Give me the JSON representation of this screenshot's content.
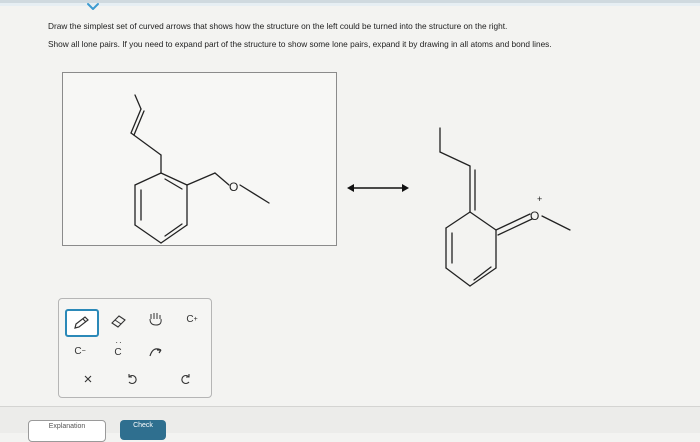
{
  "header": {
    "collapse_icon": "chevron-down-icon",
    "accent_color": "#3d9bd1"
  },
  "instructions": {
    "line1": "Draw the simplest set of curved arrows that shows how the structure on the left could be turned into the structure on the right.",
    "line2": "Show all lone pairs. If you need to expand part of the structure to show some lone pairs, expand it by drawing in all atoms and bond lines."
  },
  "left_structure": {
    "oxygen_label": "O"
  },
  "right_structure": {
    "oxygen_label": "O",
    "oxygen_charge": "+"
  },
  "resonance_arrow_icon": "double-headed-arrow-icon",
  "toolbar": {
    "tools": [
      {
        "id": "pencil",
        "icon": "pencil-icon",
        "selected": true
      },
      {
        "id": "eraser",
        "icon": "eraser-icon"
      },
      {
        "id": "hand",
        "icon": "hand-icon"
      },
      {
        "id": "cation",
        "label": "C",
        "superscript": "+"
      },
      {
        "id": "anion",
        "label": "C",
        "superscript": "−"
      },
      {
        "id": "lone-pair",
        "label": "C"
      },
      {
        "id": "curved-arrow",
        "icon": "curved-arrow-icon"
      },
      {
        "id": "clear",
        "icon": "x-icon"
      },
      {
        "id": "undo",
        "icon": "undo-icon"
      },
      {
        "id": "redo",
        "icon": "redo-icon"
      }
    ],
    "selected_color": "#2b89b8"
  },
  "buttons": {
    "explanation_label": "Explanation",
    "check_label": "Check",
    "check_color": "#2f6f8f"
  }
}
